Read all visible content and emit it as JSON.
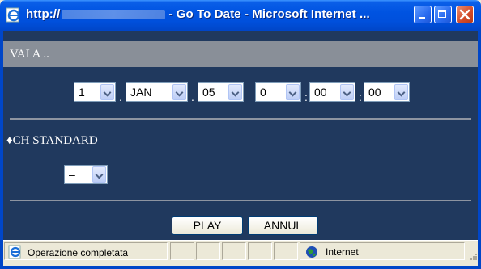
{
  "window": {
    "title_prefix": "http://",
    "title_suffix": "- Go To Date - Microsoft Internet ..."
  },
  "page": {
    "header": "VAI A ..",
    "date_time": {
      "day": "1",
      "month": "JAN",
      "year": "05",
      "hour": "0",
      "minute": "00",
      "second": "00",
      "date_separator": ".",
      "time_separator": ":"
    },
    "channel_label": "♦CH STANDARD",
    "channel_value": "–",
    "play_button": "PLAY",
    "cancel_button": "ANNUL"
  },
  "statusbar": {
    "status_text": "Operazione completata",
    "zone_text": "Internet"
  },
  "colors": {
    "titlebar": "#0053e1",
    "page_background": "#20395e",
    "header_bar": "#898f98"
  }
}
